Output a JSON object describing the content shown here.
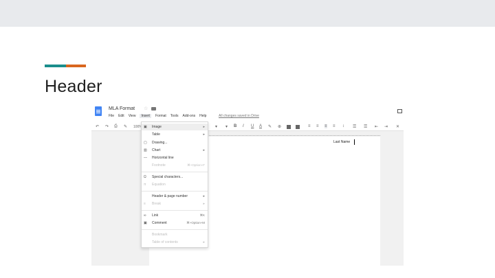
{
  "slide": {
    "title": "Header"
  },
  "doc": {
    "title": "MLA Format",
    "saved_text": "All changes saved in Drive",
    "menus": [
      "File",
      "Edit",
      "View",
      "Insert",
      "Format",
      "Tools",
      "Add-ons",
      "Help"
    ],
    "active_menu": "Insert",
    "zoom": "100%",
    "body_text": "Last Name"
  },
  "insert_menu": {
    "items": [
      {
        "label": "Image",
        "shortcut": "",
        "icon": "image-icon",
        "arrow": "▸"
      },
      {
        "label": "Table",
        "shortcut": "",
        "icon": "",
        "arrow": "▸"
      },
      {
        "label": "Drawing...",
        "shortcut": "",
        "icon": "drawing-icon",
        "arrow": ""
      },
      {
        "label": "Chart",
        "shortcut": "",
        "icon": "chart-icon",
        "arrow": "▸"
      },
      {
        "label": "Horizontal line",
        "shortcut": "",
        "icon": "horizontal-line-icon",
        "arrow": ""
      },
      {
        "label": "Footnote",
        "shortcut": "⌘+Option+F",
        "icon": "",
        "arrow": ""
      },
      {
        "label": "Special characters...",
        "shortcut": "",
        "icon": "omega-icon",
        "arrow": ""
      },
      {
        "label": "Equation",
        "shortcut": "",
        "icon": "equation-icon",
        "arrow": ""
      },
      {
        "label": "Header & page number",
        "shortcut": "",
        "icon": "",
        "arrow": "▸"
      },
      {
        "label": "Break",
        "shortcut": "",
        "icon": "break-icon",
        "arrow": "▸"
      },
      {
        "label": "Link",
        "shortcut": "⌘K",
        "icon": "link-icon",
        "arrow": ""
      },
      {
        "label": "Comment",
        "shortcut": "⌘+Option+M",
        "icon": "comment-icon",
        "arrow": ""
      },
      {
        "label": "Bookmark",
        "shortcut": "",
        "icon": "",
        "arrow": ""
      },
      {
        "label": "Table of contents",
        "shortcut": "",
        "icon": "",
        "arrow": "▸"
      }
    ]
  }
}
